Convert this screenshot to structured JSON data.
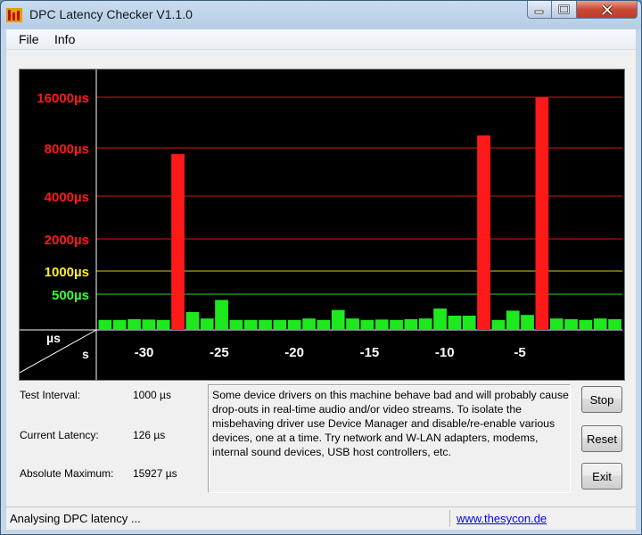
{
  "window": {
    "title": "DPC Latency Checker V1.1.0"
  },
  "menu": [
    "File",
    "Info"
  ],
  "chart_data": {
    "type": "bar",
    "y_axis_labels": [
      {
        "label": "16000µs",
        "value": 16000,
        "color": "#ff1a1a"
      },
      {
        "label": "8000µs",
        "value": 8000,
        "color": "#ff1a1a"
      },
      {
        "label": "4000µs",
        "value": 4000,
        "color": "#ff1a1a"
      },
      {
        "label": "2000µs",
        "value": 2000,
        "color": "#ff1a1a"
      },
      {
        "label": "1000µs",
        "value": 1000,
        "color": "#ffee22"
      },
      {
        "label": "500µs",
        "value": 500,
        "color": "#33ff33"
      }
    ],
    "corner_labels": {
      "y_unit": "µs",
      "x_unit": "s"
    },
    "x_ticks": [
      -30,
      -25,
      -20,
      -15,
      -10,
      -5
    ],
    "x_range": [
      -33,
      2
    ],
    "values": [
      140,
      140,
      150,
      145,
      140,
      7500,
      250,
      160,
      420,
      140,
      140,
      140,
      140,
      140,
      160,
      140,
      280,
      160,
      140,
      145,
      140,
      150,
      160,
      300,
      200,
      200,
      10000,
      140,
      270,
      210,
      15927,
      160,
      150,
      140,
      160,
      150
    ],
    "colors": {
      "normal": "#1ee81e",
      "high": "#ff1a1a",
      "red_threshold": 1000
    }
  },
  "stats": [
    {
      "label": "Test Interval:",
      "value": "1000 µs"
    },
    {
      "label": "Current Latency:",
      "value": "126 µs"
    },
    {
      "label": "Absolute Maximum:",
      "value": "15927 µs"
    }
  ],
  "message": "Some device drivers on this machine behave bad and will probably cause drop-outs in real-time audio and/or video streams. To isolate the misbehaving driver use Device Manager and disable/re-enable various devices, one at a time. Try network and W-LAN adapters, modems, internal sound devices, USB host controllers, etc.",
  "buttons": {
    "stop": "Stop",
    "reset": "Reset",
    "exit": "Exit"
  },
  "status": {
    "text": "Analysing DPC latency ...",
    "link": "www.thesycon.de"
  }
}
